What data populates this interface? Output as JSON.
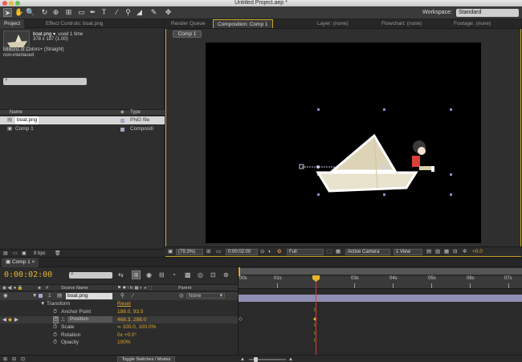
{
  "window": {
    "title": "Untitled Project.aep *"
  },
  "toolbar": {
    "workspace_label": "Workspace:",
    "workspace_value": "Standard"
  },
  "project": {
    "tabs": [
      "Project",
      "Effect Controls: boat.png"
    ],
    "selected_name": "boat.png ▾",
    "selected_usage": ", used 1 time",
    "dims": "378 x 187 (1.00)",
    "colors": "Millions of Colors+ (Straight)",
    "interlace": "non-interlaced",
    "columns": {
      "name": "Name",
      "type": "Type"
    },
    "items": [
      {
        "name": "boat.png",
        "type": "PNG file"
      },
      {
        "name": "Comp 1",
        "type": "Compositi"
      }
    ],
    "bpc": "8 bpc"
  },
  "viewer": {
    "tabs": [
      "Render Queue",
      "Composition: Comp 1",
      "Layer: (none)",
      "Flowchart: (none)",
      "Footage: (none)"
    ],
    "subtab": "Comp 1",
    "zoom": "(79.3%)",
    "timecode": "0:00:02:00",
    "resolution": "Full",
    "camera": "Active Camera",
    "view": "1 View",
    "exposure": "+0.0"
  },
  "timeline": {
    "tab": "Comp 1",
    "timecode": "0:00:02:00",
    "columns": {
      "source_name": "Source Name",
      "parent": "Parent"
    },
    "layer": {
      "index": "1",
      "name": "boat.png",
      "parent": "None"
    },
    "transform": {
      "label": "Transform",
      "reset": "Reset"
    },
    "properties": [
      {
        "name": "Anchor Point",
        "value": "188.0, 93.5"
      },
      {
        "name": "Position",
        "value": "468.3, 288.0"
      },
      {
        "name": "Scale",
        "value": "∞ 100.0, 100.0%"
      },
      {
        "name": "Rotation",
        "value": "0x +0.0°"
      },
      {
        "name": "Opacity",
        "value": "100%"
      }
    ],
    "ruler": [
      "00s",
      "01s",
      "02s",
      "03s",
      "04s",
      "05s",
      "06s",
      "07s"
    ],
    "toggle_label": "Toggle Switches / Modes"
  },
  "colors": {
    "accent": "#e8b52a",
    "track": "#8f8fb3",
    "playhead": "#d93a3a"
  }
}
